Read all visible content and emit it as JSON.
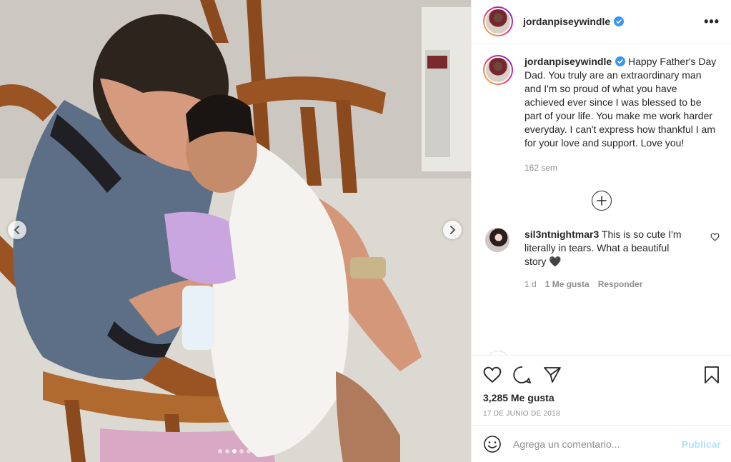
{
  "post": {
    "username": "jordanpiseywindle",
    "more_label": "•••",
    "caption": "Happy Father's Day Dad. You truly are an extraordinary man and I'm so proud of what you have achieved ever since I was blessed to be part of your life. You make me work harder everyday. I can't express how thankful I am for your love and support. Love you!",
    "caption_time": "162 sem",
    "likes": "3,285 Me gusta",
    "date": "17 DE JUNIO DE 2018"
  },
  "comments": [
    {
      "username": "sil3ntnightmar3",
      "text": "This is so cute I'm literally in tears. What a beautiful story 🖤",
      "time": "1 d",
      "likes": "1 Me gusta",
      "reply_label": "Responder"
    }
  ],
  "composer": {
    "placeholder": "Agrega un comentario...",
    "publish_label": "Publicar"
  },
  "carousel": {
    "slide_count": 5,
    "active_index": 2
  },
  "colors": {
    "accent_blue": "#0095f6",
    "publish_disabled": "#b2dffc",
    "verified": "#3897f0"
  },
  "icons": [
    "chevron-left-icon",
    "chevron-right-icon",
    "verified-icon",
    "more-icon",
    "plus-circle-icon",
    "heart-icon",
    "comment-icon",
    "share-icon",
    "bookmark-icon",
    "emoji-icon"
  ]
}
